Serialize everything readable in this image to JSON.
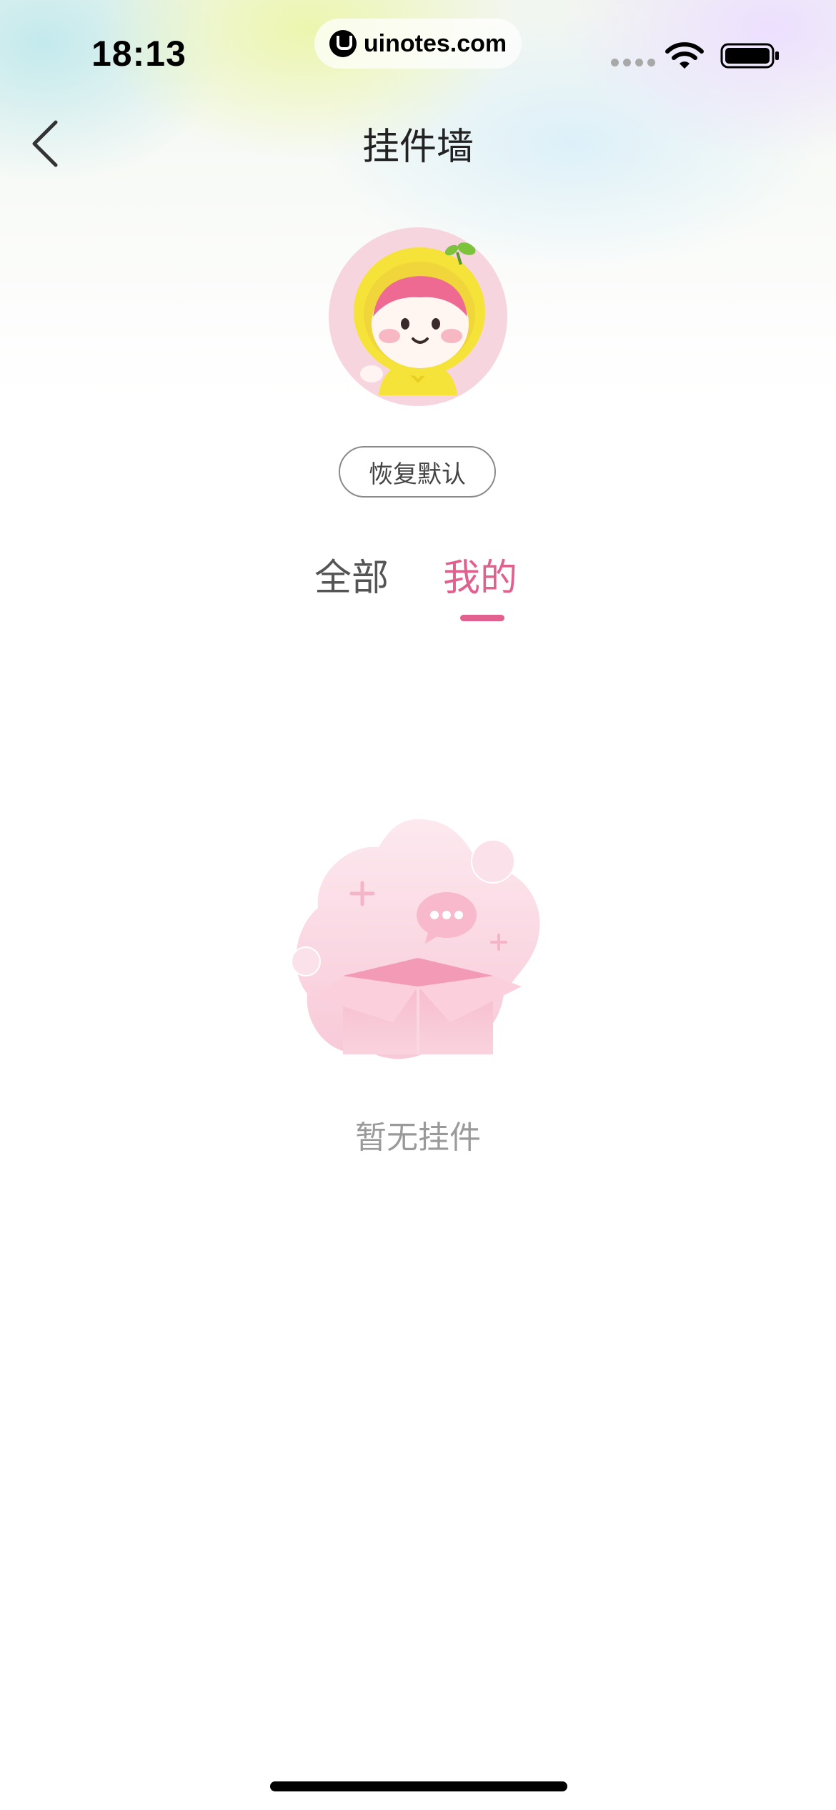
{
  "status_bar": {
    "time": "18:13",
    "url": "uinotes.com"
  },
  "header": {
    "title": "挂件墙",
    "back_icon": "chevron-left-icon"
  },
  "avatar": {
    "icon": "cartoon-lemon-girl-avatar"
  },
  "restore_button": {
    "label": "恢复默认"
  },
  "tabs": [
    {
      "label": "全部",
      "active": false
    },
    {
      "label": "我的",
      "active": true
    }
  ],
  "empty_state": {
    "icon": "empty-box-icon",
    "text": "暂无挂件"
  },
  "colors": {
    "accent": "#e2608d",
    "text_primary": "#222222",
    "text_secondary": "#9a9a9a"
  }
}
